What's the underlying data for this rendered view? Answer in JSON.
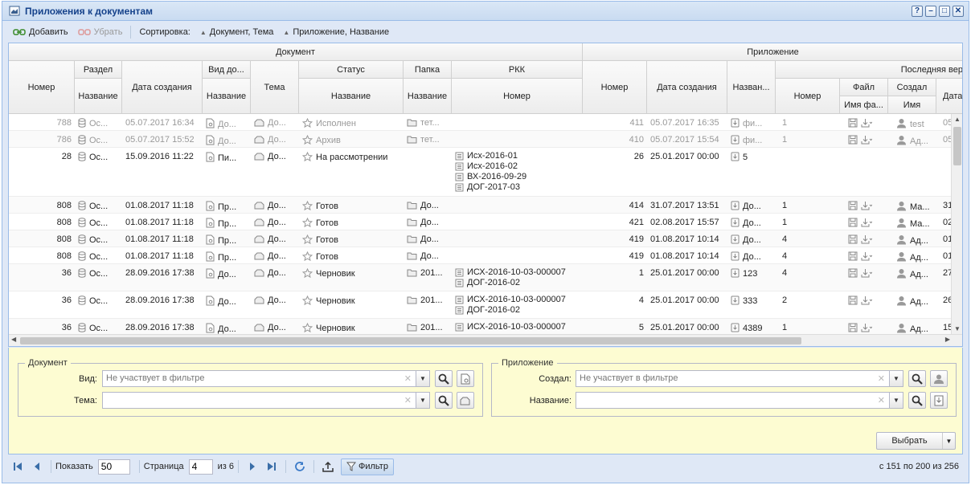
{
  "window": {
    "title": "Приложения к документам",
    "buttons": [
      "?",
      "–",
      "□",
      "✕"
    ]
  },
  "toolbar": {
    "add_label": "Добавить",
    "remove_label": "Убрать",
    "sort_label": "Сортировка:",
    "sort1": "Документ, Тема",
    "sort2": "Приложение, Название"
  },
  "columns": {
    "group_document": "Документ",
    "group_attachment": "Приложение",
    "razdel": "Раздел",
    "vid": "Вид до...",
    "status": "Статус",
    "papka": "Папка",
    "rkk": "РКК",
    "nomer": "Номер",
    "nazvanie": "Название",
    "data_sozdaniya": "Дата создания",
    "tema": "Тема",
    "att_nomer": "Номер",
    "att_data": "Дата создания",
    "att_nazvanie": "Назван...",
    "last_version": "Последняя вер",
    "fail": "Файл",
    "sozdal": "Создал",
    "lv_nomer": "Номер",
    "imya_faila": "Имя фа...",
    "imya": "Имя",
    "data_short": "Дата"
  },
  "rows": [
    {
      "num": "788",
      "razdel": "Ос...",
      "date": "05.07.2017 16:34",
      "vid": "До...",
      "tema": "До...",
      "status": "Исполнен",
      "papka": "тет...",
      "rkk": [],
      "anum": "411",
      "adate": "05.07.2017 16:35",
      "aname": "фи...",
      "lvnum": "1",
      "user": "test",
      "ldate": "05",
      "gray": true
    },
    {
      "num": "786",
      "razdel": "Ос...",
      "date": "05.07.2017 15:52",
      "vid": "До...",
      "tema": "До...",
      "status": "Архив",
      "papka": "тет...",
      "rkk": [],
      "anum": "410",
      "adate": "05.07.2017 15:54",
      "aname": "фи...",
      "lvnum": "1",
      "user": "Ад...",
      "ldate": "05",
      "gray": true
    },
    {
      "num": "28",
      "razdel": "Ос...",
      "date": "15.09.2016 11:22",
      "vid": "Пи...",
      "tema": "До...",
      "status": "На рассмотрении",
      "papka": "",
      "rkk": [
        "Исх-2016-01",
        "Исх-2016-02",
        "ВХ-2016-09-29",
        "ДОГ-2017-03"
      ],
      "anum": "26",
      "adate": "25.01.2017 00:00",
      "aname": "5",
      "lvnum": "",
      "user": "",
      "ldate": "",
      "gray": false
    },
    {
      "num": "808",
      "razdel": "Ос...",
      "date": "01.08.2017 11:18",
      "vid": "Пр...",
      "tema": "До...",
      "status": "Готов",
      "papka": "До...",
      "rkk": [],
      "anum": "414",
      "adate": "31.07.2017 13:51",
      "aname": "До...",
      "lvnum": "1",
      "user": "Ма...",
      "ldate": "31",
      "gray": false
    },
    {
      "num": "808",
      "razdel": "Ос...",
      "date": "01.08.2017 11:18",
      "vid": "Пр...",
      "tema": "До...",
      "status": "Готов",
      "papka": "До...",
      "rkk": [],
      "anum": "421",
      "adate": "02.08.2017 15:57",
      "aname": "До...",
      "lvnum": "1",
      "user": "Ма...",
      "ldate": "02",
      "gray": false
    },
    {
      "num": "808",
      "razdel": "Ос...",
      "date": "01.08.2017 11:18",
      "vid": "Пр...",
      "tema": "До...",
      "status": "Готов",
      "papka": "До...",
      "rkk": [],
      "anum": "419",
      "adate": "01.08.2017 10:14",
      "aname": "До...",
      "lvnum": "4",
      "user": "Ад...",
      "ldate": "01",
      "gray": false
    },
    {
      "num": "808",
      "razdel": "Ос...",
      "date": "01.08.2017 11:18",
      "vid": "Пр...",
      "tema": "До...",
      "status": "Готов",
      "papka": "До...",
      "rkk": [],
      "anum": "419",
      "adate": "01.08.2017 10:14",
      "aname": "До...",
      "lvnum": "4",
      "user": "Ад...",
      "ldate": "01",
      "gray": false
    },
    {
      "num": "36",
      "razdel": "Ос...",
      "date": "28.09.2016 17:38",
      "vid": "До...",
      "tema": "До...",
      "status": "Черновик",
      "papka": "201...",
      "rkk": [
        "ИСХ-2016-10-03-000007",
        "ДОГ-2016-02"
      ],
      "anum": "1",
      "adate": "25.01.2017 00:00",
      "aname": "123",
      "lvnum": "4",
      "user": "Ад...",
      "ldate": "27",
      "gray": false
    },
    {
      "num": "36",
      "razdel": "Ос...",
      "date": "28.09.2016 17:38",
      "vid": "До...",
      "tema": "До...",
      "status": "Черновик",
      "papka": "201...",
      "rkk": [
        "ИСХ-2016-10-03-000007",
        "ДОГ-2016-02"
      ],
      "anum": "4",
      "adate": "25.01.2017 00:00",
      "aname": "333",
      "lvnum": "2",
      "user": "Ад...",
      "ldate": "26",
      "gray": false
    },
    {
      "num": "36",
      "razdel": "Ос...",
      "date": "28.09.2016 17:38",
      "vid": "До...",
      "tema": "До...",
      "status": "Черновик",
      "papka": "201...",
      "rkk": [
        "ИСХ-2016-10-03-000007"
      ],
      "anum": "5",
      "adate": "25.01.2017 00:00",
      "aname": "4389",
      "lvnum": "1",
      "user": "Ад...",
      "ldate": "15",
      "gray": false
    }
  ],
  "filter": {
    "doc_legend": "Документ",
    "att_legend": "Приложение",
    "vid_label": "Вид:",
    "tema_label": "Тема:",
    "sozdal_label": "Создал:",
    "nazvanie_label": "Название:",
    "placeholder": "Не участвует в фильтре",
    "select_label": "Выбрать"
  },
  "pager": {
    "show_label": "Показать",
    "page_size": "50",
    "page_label": "Страница",
    "page": "4",
    "of_label": "из 6",
    "filter_label": "Фильтр",
    "info": "с 151 по 200 из 256"
  }
}
